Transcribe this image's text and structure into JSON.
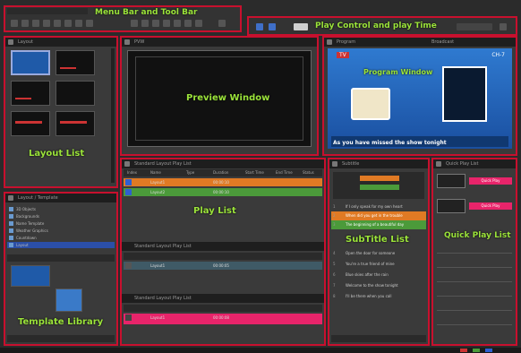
{
  "callouts": {
    "menu_tool": "Menu Bar and Tool Bar",
    "play_control": "Play Control and play Time",
    "preview": "Preview Window",
    "program": "Program Window",
    "layout": "Layout List",
    "play_list": "Play List",
    "subtitle": "SubTitle List",
    "quick_play": "Quick Play List",
    "template": "Template Library"
  },
  "headers": {
    "layout": "Layout",
    "preview": "PVW",
    "program": "Program",
    "program_extra": "Broadcast",
    "playlist1": "Standard Layout Play List",
    "playlist2": "Standard Layout Play List",
    "playlist3": "Standard Layout Play List",
    "subtitle": "Subtitle",
    "quick": "Quick Play List",
    "library": "Layout / Template"
  },
  "program_text": {
    "logo": "TV",
    "channel": "CH-7",
    "ticker": "As you have missed the show tonight"
  },
  "playlist_columns": [
    "Index",
    "Name",
    "Type",
    "Duration",
    "Start Time",
    "End Time",
    "Status"
  ],
  "playlist1_rows": [
    {
      "name": "Layout1",
      "time": "00:00:10"
    },
    {
      "name": "Layout2",
      "time": "00:00:10"
    }
  ],
  "playlist2_rows": [
    {
      "name": "Layout1",
      "time": "00:00:05"
    }
  ],
  "playlist3_rows": [
    {
      "name": "Layout1",
      "time": "00:00:08"
    }
  ],
  "library_items": [
    "3D Objects",
    "Backgrounds",
    "Name Template",
    "Weather Graphics",
    "Countdown",
    "Layout"
  ],
  "subtitle_rows": [
    "If I only speak for my own heart",
    "When did you get in the trouble",
    "The beginning of a beautiful day",
    "Open the door for someone",
    "You're a true friend of mine",
    "Blue skies after the rain",
    "Welcome to the show tonight",
    "I'll be there when you call"
  ],
  "quick_items": [
    {
      "label": "Quick Play"
    },
    {
      "label": "Quick Play"
    }
  ],
  "colors": {
    "callout": "#9be33a",
    "border": "#c8102e",
    "orange_row": "#e07a24",
    "green_row": "#4b9a3a",
    "pink": "#e8246a"
  }
}
